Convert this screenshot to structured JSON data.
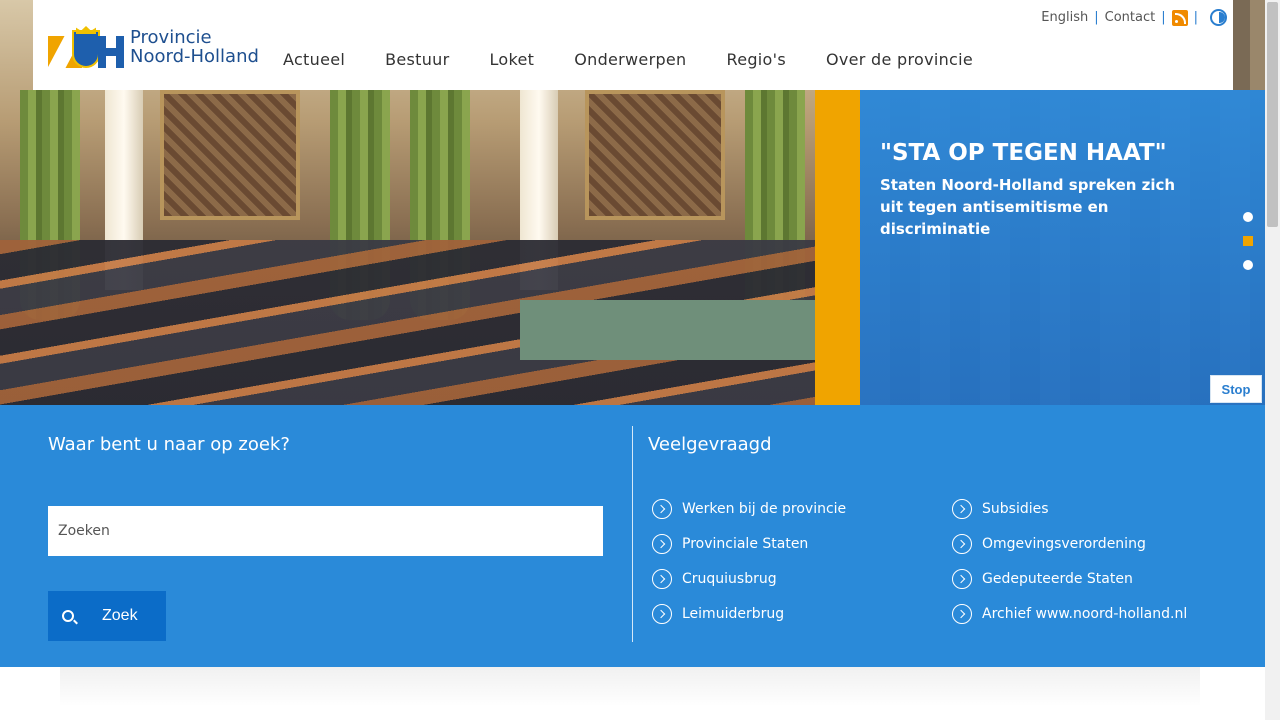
{
  "header": {
    "logo_line1": "Provincie",
    "logo_line2": "Noord-Holland",
    "nav": [
      "Actueel",
      "Bestuur",
      "Loket",
      "Onderwerpen",
      "Regio's",
      "Over de provincie"
    ],
    "util": {
      "english": "English",
      "contact": "Contact",
      "rss_icon": "rss-icon",
      "contrast_icon": "contrast-icon"
    }
  },
  "hero": {
    "title": "\"STA OP TEGEN HAAT\"",
    "subtitle": "Staten Noord-Holland spreken zich uit tegen antisemitisme en discriminatie",
    "stop_label": "Stop",
    "active_slide": 2,
    "slide_count": 3
  },
  "search": {
    "heading": "Waar bent u naar op zoek?",
    "placeholder": "Zoeken",
    "button_label": "Zoek"
  },
  "faq": {
    "heading": "Veelgevraagd",
    "col1": [
      "Werken bij de provincie",
      "Provinciale Staten",
      "Cruquiusbrug",
      "Leimuiderbrug"
    ],
    "col2": [
      "Subsidies",
      "Omgevingsverordening",
      "Gedeputeerde Staten",
      "Archief www.noord-holland.nl"
    ]
  },
  "colors": {
    "brand_blue": "#2a8ad9",
    "accent_orange": "#f0a400",
    "dark_blue": "#0b6cc8"
  }
}
